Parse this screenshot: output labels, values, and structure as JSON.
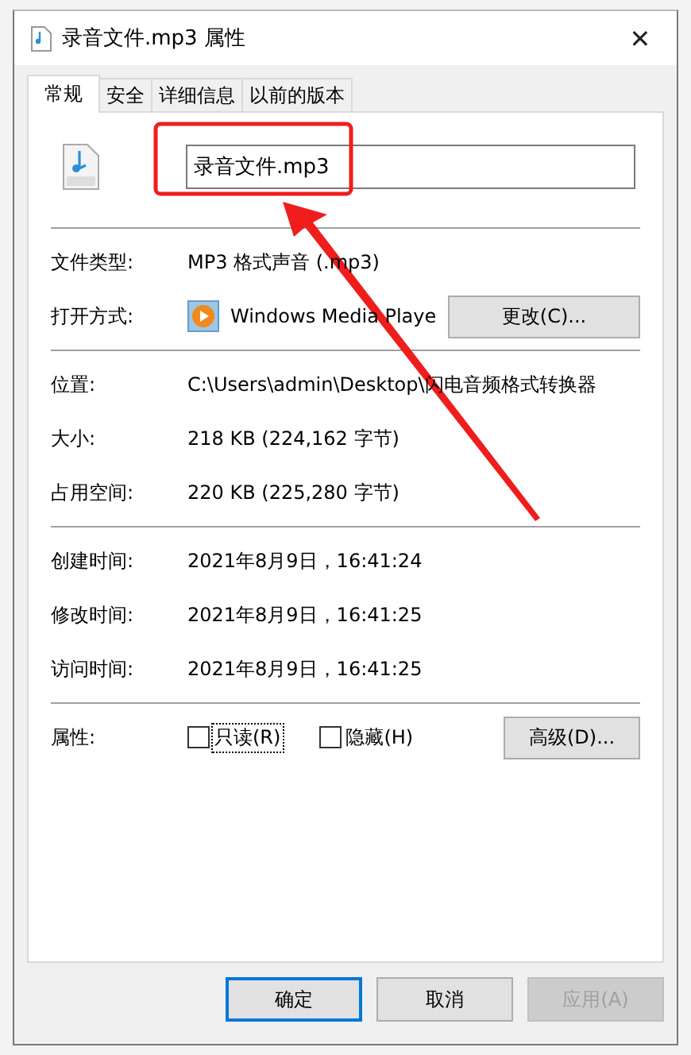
{
  "window": {
    "title": "录音文件.mp3 属性",
    "close": "✕"
  },
  "tabs": [
    {
      "label": "常规",
      "selected": true
    },
    {
      "label": "安全",
      "selected": false
    },
    {
      "label": "详细信息",
      "selected": false
    },
    {
      "label": "以前的版本",
      "selected": false
    }
  ],
  "file_name": {
    "value": "录音文件.mp3"
  },
  "sections": [
    [
      {
        "label": "文件类型:",
        "value": "MP3 格式声音 (.mp3)"
      },
      {
        "label": "打开方式:",
        "value": "Windows Media Playe",
        "kind": "app",
        "button": "更改(C)..."
      }
    ],
    [
      {
        "label": "位置:",
        "value": "C:\\Users\\admin\\Desktop\\闪电音频格式转换器"
      },
      {
        "label": "大小:",
        "value": "218 KB (224,162 字节)"
      },
      {
        "label": "占用空间:",
        "value": "220 KB (225,280 字节)"
      }
    ],
    [
      {
        "label": "创建时间:",
        "value": "2021年8月9日，16:41:24"
      },
      {
        "label": "修改时间:",
        "value": "2021年8月9日，16:41:25"
      },
      {
        "label": "访问时间:",
        "value": "2021年8月9日，16:41:25"
      }
    ]
  ],
  "attributes": {
    "label": "属性:",
    "checkboxes": [
      {
        "label": "只读(R)",
        "checked": false,
        "focused": true
      },
      {
        "label": "隐藏(H)",
        "checked": false,
        "focused": false
      }
    ],
    "button": "高级(D)..."
  },
  "buttons": [
    {
      "label": "确定",
      "default": true,
      "disabled": false
    },
    {
      "label": "取消",
      "default": false,
      "disabled": false
    },
    {
      "label": "应用(A)",
      "default": false,
      "disabled": true
    }
  ]
}
